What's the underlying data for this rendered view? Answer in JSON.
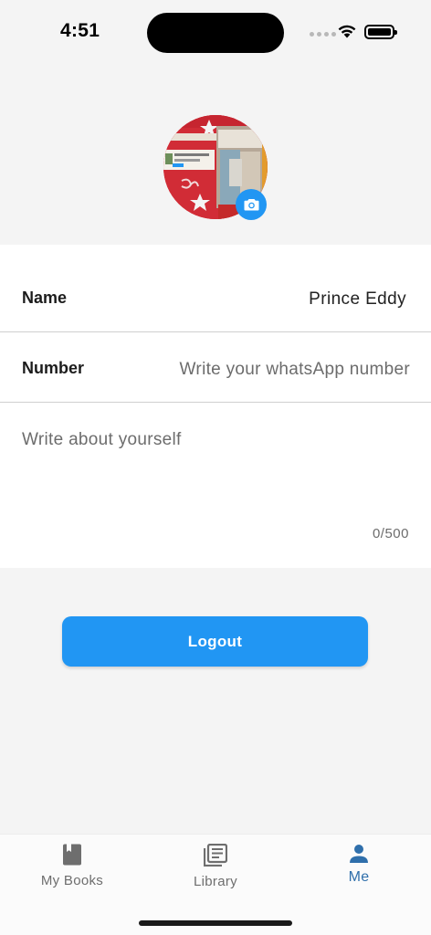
{
  "status_bar": {
    "time": "4:51"
  },
  "profile": {
    "avatar_alt": "profile photo",
    "fields": {
      "name_label": "Name",
      "name_value": "Prince Eddy",
      "number_label": "Number",
      "number_placeholder": "Write your whatsApp number",
      "about_placeholder": "Write about yourself",
      "about_counter": "0/500"
    }
  },
  "actions": {
    "logout_label": "Logout"
  },
  "bottom_nav": {
    "items": [
      {
        "label": "My Books",
        "icon": "book-icon",
        "active": false
      },
      {
        "label": "Library",
        "icon": "library-icon",
        "active": false
      },
      {
        "label": "Me",
        "icon": "person-icon",
        "active": true
      }
    ]
  },
  "colors": {
    "accent": "#2196f3",
    "active_nav": "#2f6fab",
    "background": "#f4f4f4"
  }
}
